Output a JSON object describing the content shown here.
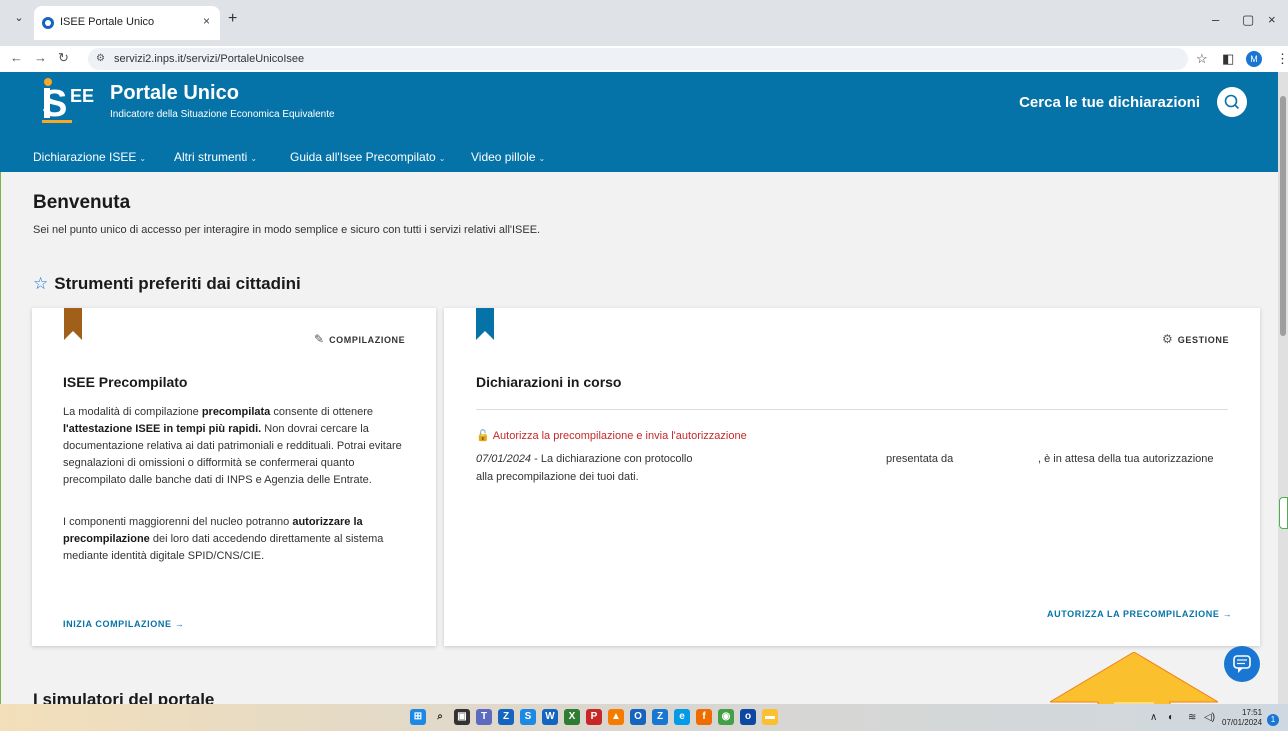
{
  "browser": {
    "tab_title": "ISEE Portale Unico",
    "tab_close": "×",
    "new_tab": "+",
    "url": "servizi2.inps.it/servizi/PortaleUnicoIsee",
    "profile_initial": "M",
    "window_minimize": "–",
    "window_restore": "▢",
    "window_close": "×"
  },
  "header": {
    "logo_text": "iSEE",
    "title": "Portale Unico",
    "subtitle": "Indicatore della Situazione Economica Equivalente",
    "search_label": "Cerca le tue dichiarazioni"
  },
  "nav": {
    "items": [
      {
        "label": "Dichiarazione ISEE"
      },
      {
        "label": "Altri strumenti"
      },
      {
        "label": "Guida all'Isee Precompilato"
      },
      {
        "label": "Video pillole"
      }
    ]
  },
  "main": {
    "welcome": "Benvenuta",
    "intro": "Sei nel punto unico di accesso per interagire in modo semplice e sicuro con tutti i servizi relativi all'ISEE.",
    "section_title": "Strumenti preferiti dai cittadini",
    "simulators_title": "I simulatori del portale"
  },
  "card_compilazione": {
    "tag": "COMPILAZIONE",
    "title": "ISEE Precompilato",
    "p1_a": "La modalità di compilazione ",
    "p1_b": "precompilata",
    "p1_c": " consente di ottenere ",
    "p1_d": "l'attestazione ISEE in tempi più rapidi.",
    "p1_e": " Non dovrai cercare la documentazione relativa ai dati patrimoniali e reddituali. Potrai evitare segnalazioni di omissioni o difformità se confermerai quanto precompilato dalle banche dati di INPS e Agenzia delle Entrate.",
    "p2_a": "I componenti maggiorenni del nucleo potranno ",
    "p2_b": "autorizzare la precompilazione",
    "p2_c": " dei loro dati accedendo direttamente al sistema mediante identità digitale SPID/CNS/CIE.",
    "link": "INIZIA COMPILAZIONE"
  },
  "card_gestione": {
    "tag": "GESTIONE",
    "title": "Dichiarazioni in corso",
    "alert": "Autorizza la precompilazione e invia l'autorizzazione",
    "date": "07/01/2024",
    "msg_a": " - La dichiarazione con protocollo",
    "msg_b": "presentata da",
    "msg_c": ", è in attesa della tua autorizzazione",
    "msg_d": "alla precompilazione dei tuoi dati.",
    "link": "AUTORIZZA LA PRECOMPILAZIONE"
  },
  "taskbar": {
    "time": "17:51",
    "date": "07/01/2024",
    "notifications": "1"
  },
  "colors": {
    "brand_blue": "#0573a8",
    "bookmark_brown": "#a0601a",
    "alert_red": "#c62828",
    "arrow_yellow": "#fbc02d"
  }
}
